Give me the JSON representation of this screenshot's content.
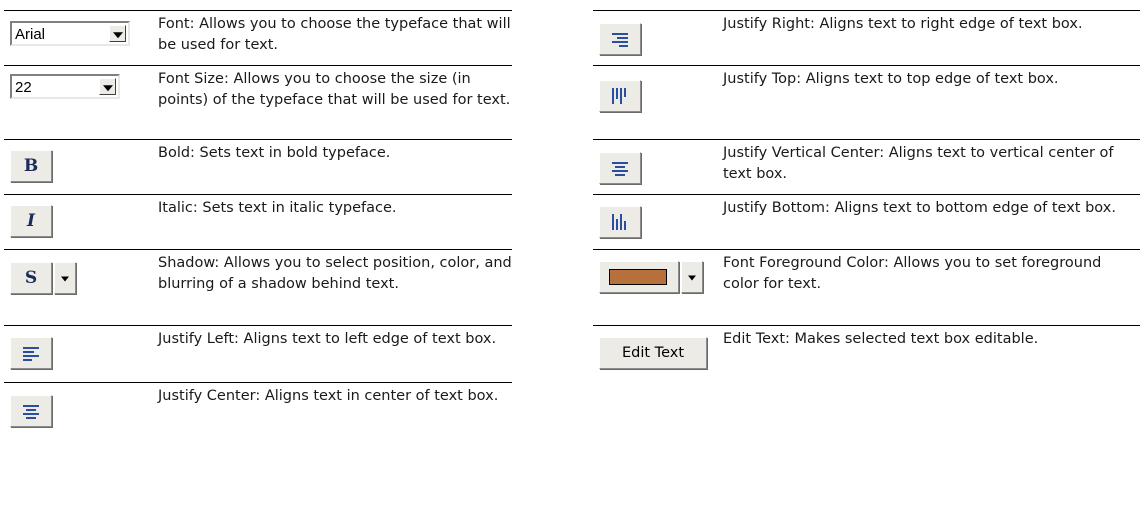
{
  "left_items": [
    {
      "description": "Font: Allows you to choose the typeface that will be used for text.",
      "control_value": "Arial"
    },
    {
      "description": "Font Size: Allows you to choose the size (in points) of the typeface that will be used for text.",
      "control_value": "22"
    },
    {
      "description": "Bold: Sets text in bold typeface.",
      "control_value": "B"
    },
    {
      "description": "Italic: Sets text in italic typeface.",
      "control_value": "I"
    },
    {
      "description": "Shadow: Allows you to select position, color, and blurring of a shadow behind text.",
      "control_value": "S"
    },
    {
      "description": "Justify Left: Aligns text to left edge of text box.",
      "control_value": "justify-left-icon"
    },
    {
      "description": "Justify Center: Aligns text in center of text box.",
      "control_value": "justify-center-icon"
    }
  ],
  "right_items": [
    {
      "description": "Justify Right: Aligns text to right edge of text box.",
      "control_value": "justify-right-icon"
    },
    {
      "description": "Justify Top: Aligns text to top edge of text box.",
      "control_value": "justify-top-icon"
    },
    {
      "description": "Justify Vertical Center: Aligns text to vertical center of text box.",
      "control_value": "justify-vertical-center-icon"
    },
    {
      "description": "Justify Bottom: Aligns text to bottom edge of text box.",
      "control_value": "justify-bottom-icon"
    },
    {
      "description": "Font Foreground Color: Allows you to set foreground color for text.",
      "control_value": "#b5703c"
    },
    {
      "description": "Edit Text: Makes selected text box editable.",
      "control_value": "Edit Text"
    }
  ],
  "colors": {
    "icon_blue": "#2b4fa0",
    "foreground_swatch": "#b5703c",
    "button_face": "#ecebe6"
  }
}
